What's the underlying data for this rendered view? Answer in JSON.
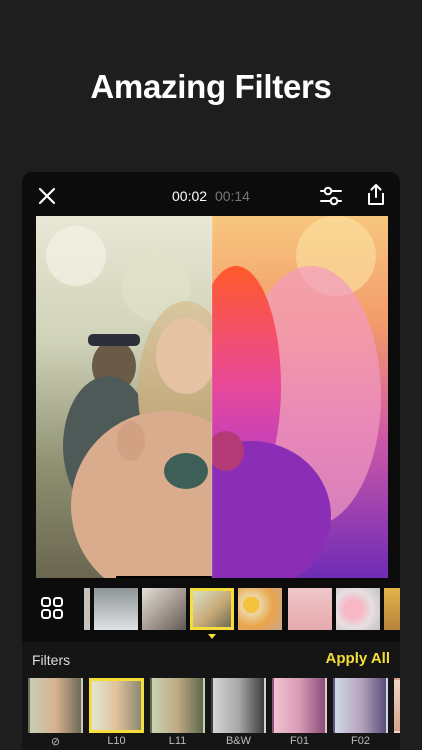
{
  "headline": "Amazing Filters",
  "editor": {
    "time_current": "00:02",
    "time_total": "00:14",
    "icons": {
      "close": "close-icon",
      "adjust": "sliders-icon",
      "share": "share-icon",
      "grid": "grid-icon"
    }
  },
  "filters": {
    "title": "Filters",
    "apply_all": "Apply All",
    "accent_color": "#f5dd3c",
    "selected": "L10",
    "items": [
      {
        "label": "⊘"
      },
      {
        "label": "L10"
      },
      {
        "label": "L11"
      },
      {
        "label": "B&W"
      },
      {
        "label": "F01"
      },
      {
        "label": "F02"
      }
    ]
  }
}
